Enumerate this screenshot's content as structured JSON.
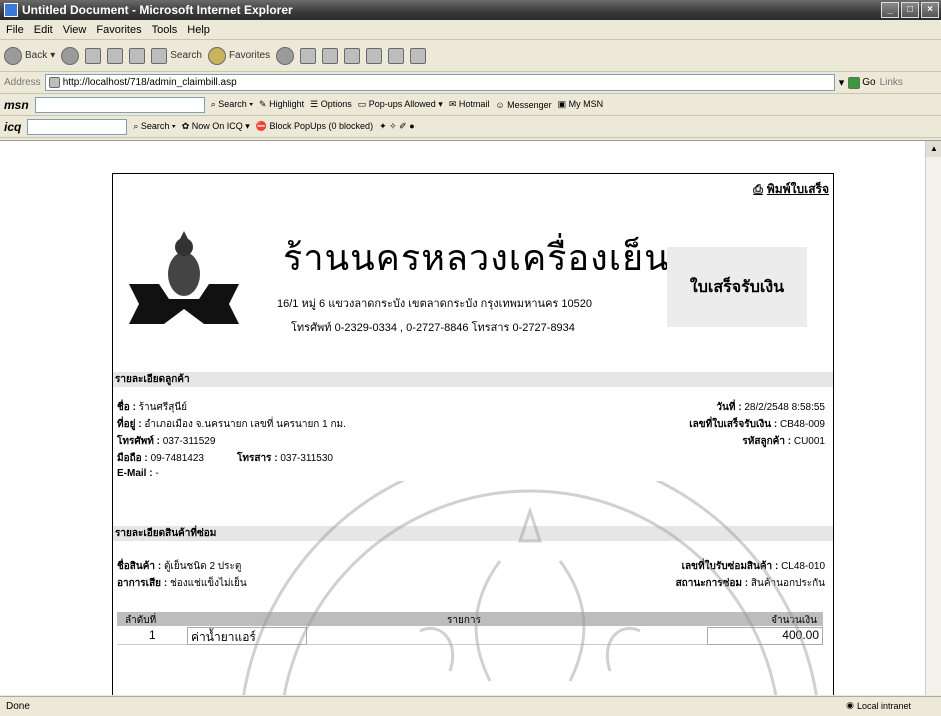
{
  "window": {
    "title": "Untitled Document - Microsoft Internet Explorer"
  },
  "menu": [
    "File",
    "Edit",
    "View",
    "Favorites",
    "Tools",
    "Help"
  ],
  "toolbar": {
    "back": "Back",
    "search": "Search",
    "favorites": "Favorites"
  },
  "address": {
    "label": "Address",
    "url": "http://localhost/718/admin_claimbill.asp",
    "go": "Go",
    "links": "Links"
  },
  "msnbar": {
    "brand": "msn",
    "search": "Search",
    "highlight": "Highlight",
    "options": "Options",
    "popups": "Pop-ups Allowed",
    "hotmail": "Hotmail",
    "messenger": "Messenger",
    "mymsn": "My MSN"
  },
  "icqbar": {
    "brand": "icq",
    "search": "Search",
    "now": "Now On ICQ",
    "block": "Block PopUps (0 blocked)"
  },
  "doc": {
    "print_label": "พิมพ์ใบเสร็จ",
    "shop_name": "ร้านนครหลวงเครื่องเย็น",
    "shop_address": "16/1 หมู่ 6 แขวงลาดกระบัง เขตลาดกระบัง กรุงเทพมหานคร 10520",
    "shop_tel": "โทรศัพท์ 0-2329-0334 , 0-2727-8846 โทรสาร 0-2727-8934",
    "receipt_title": "ใบเสร็จรับเงิน",
    "customer_section": "รายละเอียดลูกค้า",
    "customer": {
      "name_label": "ชื่อ :",
      "name": "ร้านศรีสุนีย์",
      "address_label": "ที่อยู่ :",
      "address": "อำเภอเมือง จ.นครนายก เลขที่ นครนายก 1 กม.",
      "tel_label": "โทรศัพท์ :",
      "tel": "037-311529",
      "mobile_label": "มือถือ :",
      "mobile": "09-7481423",
      "fax_label": "โทรสาร :",
      "fax": "037-311530",
      "email_label": "E-Mail :",
      "email": "-",
      "date_label": "วันที่ :",
      "date": "28/2/2548 8:58:55",
      "receipt_no_label": "เลขที่ใบเสร็จรับเงิน :",
      "receipt_no": "CB48-009",
      "customer_code_label": "รหัสลูกค้า :",
      "customer_code": "CU001"
    },
    "product_section": "รายละเอียดสินค้าที่ซ่อม",
    "product": {
      "name_label": "ชื่อสินค้า :",
      "name": "ตู้เย็นชนิด 2 ประตู",
      "symptom_label": "อาการเสีย :",
      "symptom": "ช่องแช่แข็งไม่เย็น",
      "repair_no_label": "เลขที่ใบรับซ่อมสินค้า :",
      "repair_no": "CL48-010",
      "status_label": "สถานะการซ่อม :",
      "status": "สินค้านอกประกัน"
    },
    "table": {
      "headers": [
        "ลำดับที่",
        "รายการ",
        "จำนวนเงิน"
      ],
      "rows": [
        {
          "no": "1",
          "item": "ค่าน้ำยาแอร์",
          "amount": "400.00"
        }
      ]
    }
  },
  "status": {
    "left": "Done",
    "zone": "Local intranet"
  }
}
